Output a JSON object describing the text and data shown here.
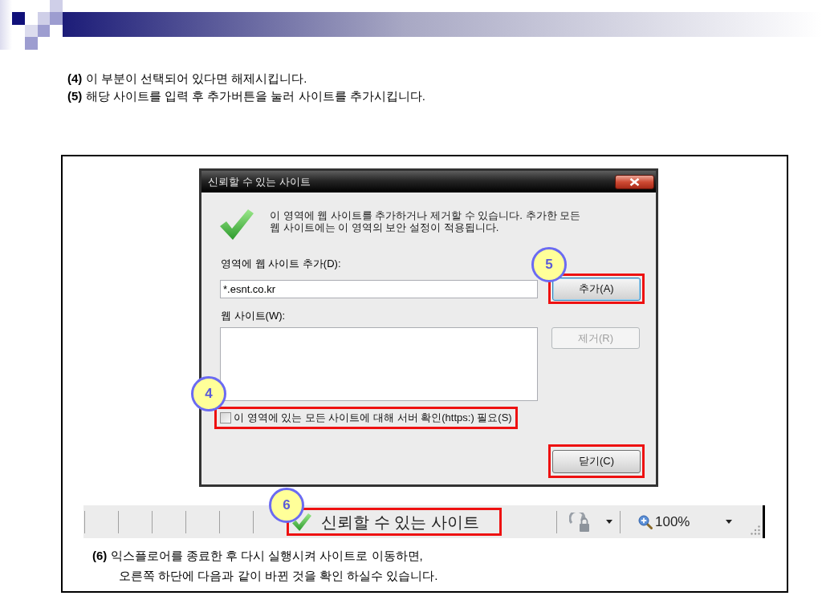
{
  "instructions": [
    "**(4)** 이 부분이 선택되어 있다면 해제시킵니다.",
    "**(5)** 해당 사이트를 입력 후 추가버튼을 눌러 사이트를 추가시킵니다."
  ],
  "dialog": {
    "title": "신뢰할 수 있는 사이트",
    "description_lines": [
      "이 영역에 웹 사이트를 추가하거나 제거할 수 있습니다. 추가한 모든",
      "웹 사이트에는 이 영역의 보안 설정이 적용됩니다."
    ],
    "add_label": "영역에 웹 사이트 추가(D):",
    "add_input": {
      "value": "*.esnt.co.kr"
    },
    "add_button": {
      "label": "추가(A)",
      "focused": true,
      "highlighted": true,
      "callout": "5"
    },
    "sites_label": "웹 사이트(W):",
    "remove_button": {
      "label": "제거(R)",
      "disabled": true
    },
    "https_checkbox": {
      "label": "이 영역에 있는 모든 사이트에 대해 서버 확인(https:) 필요(S)",
      "checked": false,
      "highlighted": true,
      "callout": "4"
    },
    "close_button": {
      "label": "닫기(C)",
      "highlighted": true
    }
  },
  "status_bar": {
    "zone": {
      "label": "신뢰할 수 있는 사이트",
      "highlighted": true,
      "callout": "6"
    },
    "zoom": "100%"
  },
  "note_lines": [
    "**(6)** 익스플로어를 종료한 후 다시 실행시켜 사이트로 이동하면,",
    "오른쪽 하단에 다음과 같이 바뀐 것을 확인 하실수 있습니다."
  ]
}
